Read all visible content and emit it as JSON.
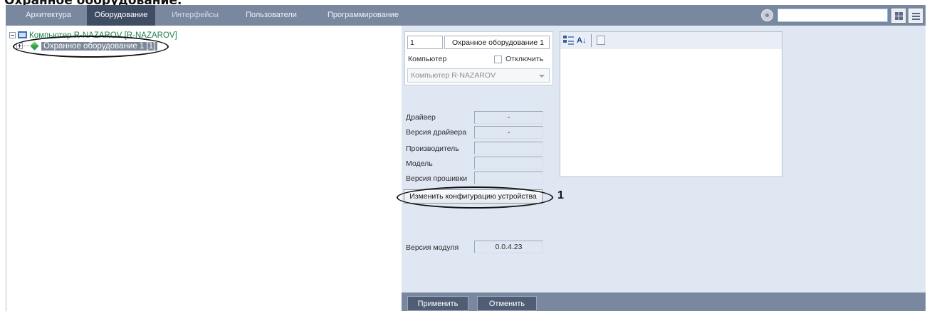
{
  "heading": "Охранное оборудование.",
  "topbar": {
    "tabs": [
      {
        "label": "Архитектура"
      },
      {
        "label": "Оборудование"
      },
      {
        "label": "Интерфейсы"
      },
      {
        "label": "Пользователи"
      },
      {
        "label": "Программирование"
      }
    ],
    "active_tab": "Оборудование",
    "search_value": ""
  },
  "tree": {
    "computer_label": "Компьютер R-NAZAROV [R-NAZAROV]",
    "device_label": "Охранное оборудование 1 [1]"
  },
  "device": {
    "id": "1",
    "name": "Охранное оборудование 1",
    "computer_label": "Компьютер",
    "disable_label": "Отключить",
    "disable_checked": false,
    "computer_value": "Компьютер R-NAZAROV"
  },
  "info": {
    "driver_label": "Драйвер",
    "driver_value": "-",
    "driver_version_label": "Версия драйвера",
    "driver_version_value": "-",
    "manufacturer_label": "Производитель",
    "manufacturer_value": "",
    "model_label": "Модель",
    "model_value": "",
    "firmware_label": "Версия прошивки",
    "firmware_value": "",
    "module_version_label": "Версия модуля",
    "module_version_value": "0.0.4.23"
  },
  "change_config_label": "Изменить конфигурацию устройства",
  "annotation_number": "1",
  "bottom": {
    "apply_label": "Применить",
    "cancel_label": "Отменить"
  },
  "colors": {
    "toolbar": "#7a889f",
    "active_tab": "#3f4d62",
    "panel": "#dfe7f3",
    "tree_text": "#1e7f4e",
    "selection": "#7c8899"
  }
}
